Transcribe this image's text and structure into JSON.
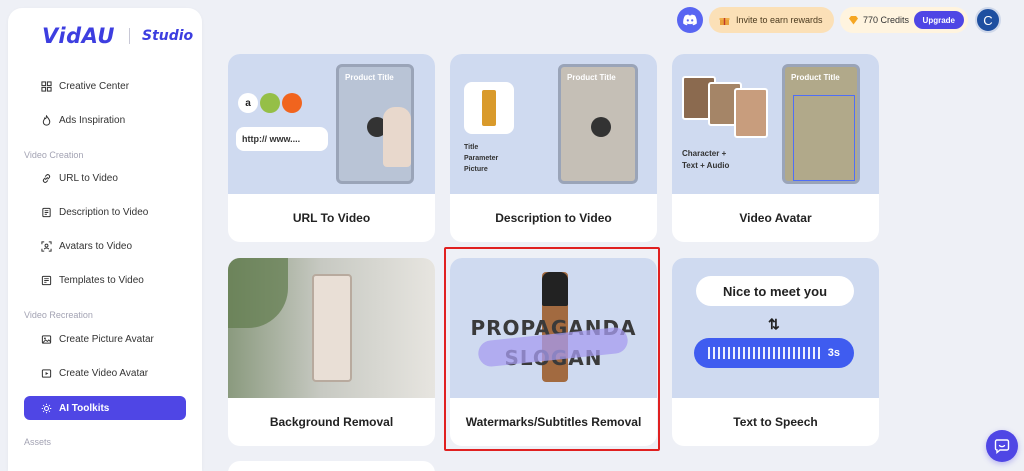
{
  "brand": {
    "logo": "VidAU",
    "product": "Studio"
  },
  "sidebar": {
    "items": [
      {
        "label": "Creative Center",
        "icon": "grid-icon"
      },
      {
        "label": "Ads Inspiration",
        "icon": "flame-icon"
      }
    ],
    "sections": [
      {
        "title": "Video Creation",
        "items": [
          {
            "label": "URL to Video",
            "icon": "link-icon"
          },
          {
            "label": "Description to Video",
            "icon": "document-icon"
          },
          {
            "label": "Avatars to Video",
            "icon": "avatar-scan-icon"
          },
          {
            "label": "Templates to Video",
            "icon": "template-icon"
          }
        ]
      },
      {
        "title": "Video Recreation",
        "items": [
          {
            "label": "Create Picture Avatar",
            "icon": "image-icon"
          },
          {
            "label": "Create Video Avatar",
            "icon": "video-icon"
          },
          {
            "label": "AI Toolkits",
            "icon": "sparkle-icon",
            "active": true
          }
        ]
      },
      {
        "title": "Assets",
        "items": []
      }
    ]
  },
  "topbar": {
    "invite_label": "Invite to earn rewards",
    "credits_label": "770 Credits",
    "upgrade_label": "Upgrade",
    "avatar_initial": "C"
  },
  "cards": [
    {
      "label": "URL To Video",
      "thumb": {
        "product_title": "Product Title",
        "url_text": "http:// www...."
      }
    },
    {
      "label": "Description to Video",
      "thumb": {
        "product_title": "Product Title",
        "caption": [
          "Title",
          "Parameter",
          "Picture"
        ]
      }
    },
    {
      "label": "Video Avatar",
      "thumb": {
        "product_title": "Product Title",
        "caption": [
          "Character +",
          "Text + Audio"
        ]
      }
    },
    {
      "label": "Background Removal"
    },
    {
      "label": "Watermarks/Subtitles Removal",
      "thumb": {
        "line1": "PROPAGANDA",
        "line2": "SLOGAN"
      }
    },
    {
      "label": "Text to Speech",
      "thumb": {
        "bubble": "Nice to meet you",
        "duration": "3s"
      }
    }
  ],
  "colors": {
    "accent": "#4f46e5",
    "brand": "#3d3ee0",
    "highlight": "#e02020",
    "thumb_bg": "#cfdaf0"
  }
}
